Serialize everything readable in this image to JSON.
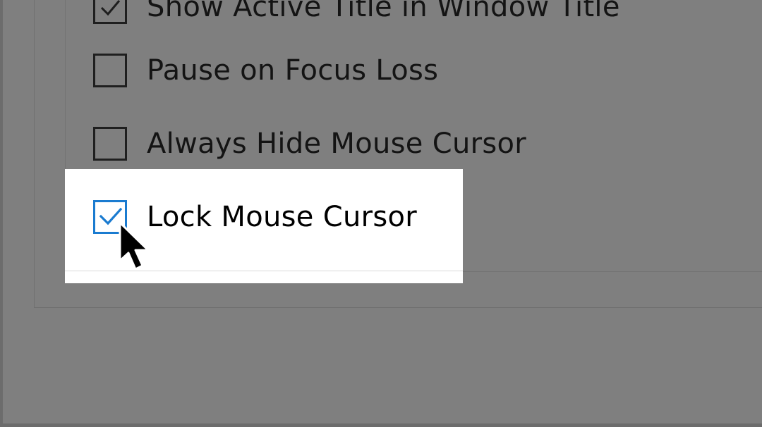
{
  "options": [
    {
      "label": "Show Active Title in Window Title",
      "checked": true
    },
    {
      "label": "Pause on Focus Loss",
      "checked": false
    },
    {
      "label": "Always Hide Mouse Cursor",
      "checked": false
    },
    {
      "label": "Lock Mouse Cursor",
      "checked": true
    }
  ],
  "colors": {
    "accent": "#1a7bd0",
    "overlay": "#7f7f7f",
    "highlight": "#ffffff"
  },
  "icons": {
    "check": "checkmark-icon",
    "cursor": "mouse-pointer-icon"
  }
}
